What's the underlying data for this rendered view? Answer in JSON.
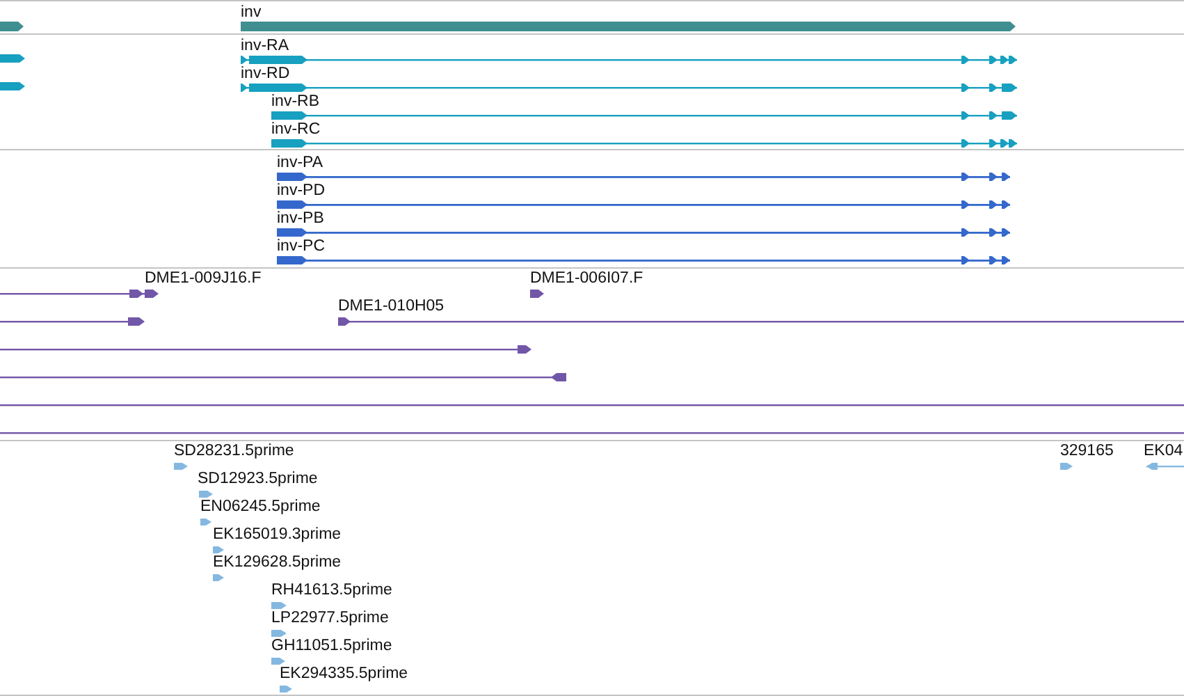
{
  "tracks": [
    {
      "kind": "gene",
      "color": "#3f8f91",
      "features": [
        {
          "kind": "arrow",
          "reverse": false
        },
        {
          "kind": "arrow",
          "label": "inv",
          "reverse": false
        }
      ]
    },
    {
      "kind": "transcript",
      "color": "#17a0c0",
      "features": [
        {
          "kind": "arrow",
          "reverse": false
        },
        {
          "kind": "arrow",
          "reverse": false
        },
        {
          "kind": "arrow",
          "label": "inv-RA",
          "reverse": false
        },
        {
          "kind": "arrow",
          "label": "inv-RD",
          "reverse": false
        },
        {
          "kind": "arrow",
          "label": "inv-RB",
          "reverse": false
        },
        {
          "kind": "arrow",
          "label": "inv-RC",
          "reverse": false
        }
      ]
    },
    {
      "kind": "protein",
      "color": "#3468cc",
      "features": [
        {
          "kind": "arrow",
          "label": "inv-PA",
          "reverse": false
        },
        {
          "kind": "arrow",
          "label": "inv-PD",
          "reverse": false
        },
        {
          "kind": "arrow",
          "label": "inv-PB",
          "reverse": false
        },
        {
          "kind": "arrow",
          "label": "inv-PC",
          "reverse": false
        }
      ]
    },
    {
      "kind": "cdna",
      "color": "#7256a8",
      "features": [
        {
          "kind": "arrow",
          "label": "DME1-009J16.F",
          "reverse": false
        },
        {
          "kind": "arrow",
          "reverse": false
        },
        {
          "kind": "arrow",
          "label": "DME1-006I07.F",
          "reverse": false
        },
        {
          "kind": "arrow",
          "label": "DME1-010H05",
          "reverse": false
        },
        {
          "kind": "arrow",
          "reverse": false
        },
        {
          "kind": "arrow",
          "reverse": true
        },
        {
          "kind": "line"
        },
        {
          "kind": "line"
        }
      ]
    },
    {
      "kind": "est",
      "color": "#84b8e0",
      "features": [
        {
          "kind": "arrow",
          "label": "SD28231.5prime",
          "reverse": false
        },
        {
          "kind": "arrow",
          "label": "SD12923.5prime",
          "reverse": false
        },
        {
          "kind": "arrow",
          "label": "EN06245.5prime",
          "reverse": false
        },
        {
          "kind": "arrow",
          "label": "EK165019.3prime",
          "reverse": false
        },
        {
          "kind": "arrow",
          "label": "EK129628.5prime",
          "reverse": false
        },
        {
          "kind": "arrow",
          "label": "RH41613.5prime",
          "reverse": false
        },
        {
          "kind": "arrow",
          "label": "LP22977.5prime",
          "reverse": false
        },
        {
          "kind": "arrow",
          "label": "GH11051.5prime",
          "reverse": false
        },
        {
          "kind": "arrow",
          "label": "EK294335.5prime",
          "reverse": false
        },
        {
          "kind": "arrow",
          "label": "329165",
          "reverse": false
        },
        {
          "kind": "arrow",
          "label": "EK04",
          "reverse": true
        }
      ]
    }
  ]
}
